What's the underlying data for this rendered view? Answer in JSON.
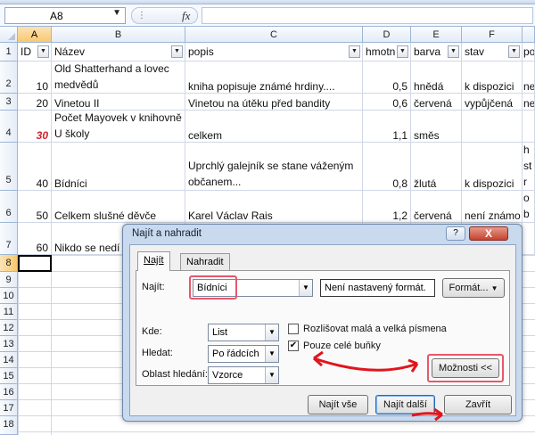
{
  "formula_bar": {
    "cell_ref": "A8",
    "fx_label": "fx",
    "grip": "⋮",
    "formula": ""
  },
  "columns": [
    {
      "letter": "A",
      "label": "ID",
      "filter": "▼"
    },
    {
      "letter": "B",
      "label": "Název",
      "filter": "▼"
    },
    {
      "letter": "C",
      "label": "popis",
      "filter": "▼"
    },
    {
      "letter": "D",
      "label": "hmotn",
      "filter": "▼"
    },
    {
      "letter": "E",
      "label": "barva",
      "filter": "▼"
    },
    {
      "letter": "F",
      "label": "stav",
      "filter": "▼"
    },
    {
      "letter": "",
      "label": "po",
      "filter": ""
    }
  ],
  "rows": [
    {
      "num": "1"
    },
    {
      "num": "2",
      "id": "10",
      "nazev": "Old Shatterhand a lovec medvědů",
      "popis": "kniha popisuje známé hrdiny....",
      "hmotn": "0,5",
      "barva": "hnědá",
      "stav": "k dispozici",
      "po": "ne"
    },
    {
      "num": "3",
      "id": "20",
      "nazev": "Vinetou II",
      "popis": "Vinetou na útěku před bandity",
      "hmotn": "0,6",
      "barva": "červená",
      "stav": "vypůjčená",
      "po": "ne"
    },
    {
      "num": "4",
      "id": "30",
      "nazev": "Počet Mayovek v knihovně U školy",
      "popis": "celkem",
      "hmotn": "1,1",
      "barva": "směs",
      "stav": "",
      "po": ""
    },
    {
      "num": "5",
      "id": "40",
      "nazev": "Bídníci",
      "popis": "Uprchlý galejník se stane váženým občanem...",
      "hmotn": "0,8",
      "barva": "žlutá",
      "stav": "k dispozici",
      "po": "po Ch str"
    },
    {
      "num": "6",
      "id": "50",
      "nazev": "Celkem slušné děvče",
      "popis": "Karel Václav Rais",
      "hmotn": "1,2",
      "barva": "červená",
      "stav": "není známo",
      "po": "dil ob"
    },
    {
      "num": "7",
      "id": "60",
      "nazev": "Nikdo se nedí",
      "popis": "",
      "hmotn": "",
      "barva": "",
      "stav": "",
      "po": ""
    },
    {
      "num": "8"
    },
    {
      "num": "9"
    },
    {
      "num": "10"
    },
    {
      "num": "11"
    },
    {
      "num": "12"
    },
    {
      "num": "13"
    },
    {
      "num": "14"
    },
    {
      "num": "15"
    },
    {
      "num": "16"
    },
    {
      "num": "17"
    },
    {
      "num": "18"
    }
  ],
  "dialog": {
    "title": "Najít a nahradit",
    "help": "?",
    "close": "X",
    "tabs": {
      "find": "Najít",
      "replace": "Nahradit"
    },
    "find_label": "Najít:",
    "find_value": "Bídníci",
    "format_status": "Není nastavený formát.",
    "format_button": "Formát...",
    "within_label": "Kde:",
    "within_value": "List",
    "search_label": "Hledat:",
    "search_value": "Po řádcích",
    "lookin_label": "Oblast hledání:",
    "lookin_value": "Vzorce",
    "match_case_label": "Rozlišovat malá a velká písmena",
    "match_case_checked": false,
    "entire_cell_label": "Pouze celé buňky",
    "entire_cell_checked": true,
    "options_button": "Možnosti <<",
    "find_all_button": "Najít vše",
    "find_next_button": "Najít další",
    "close_button": "Zavřít"
  },
  "colors": {
    "highlight": "#e8576a",
    "annotation_red": "#e0161c",
    "selected_header": "#f9c86f",
    "red_id": "#d0242b"
  }
}
